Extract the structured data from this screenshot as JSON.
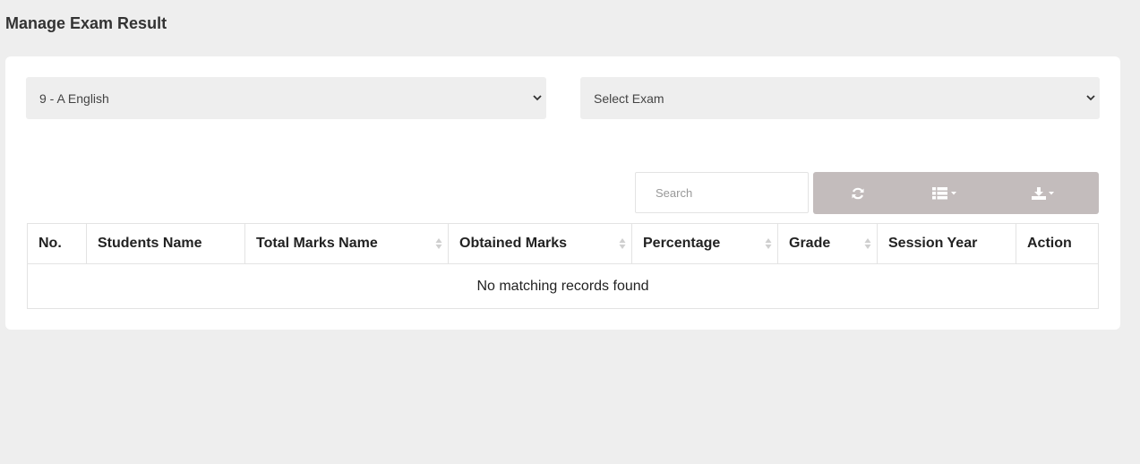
{
  "page": {
    "title": "Manage Exam Result"
  },
  "filters": {
    "class_subject": {
      "selected": "9 - A English"
    },
    "exam": {
      "selected": "Select Exam"
    }
  },
  "table_tools": {
    "search_placeholder": "Search",
    "icons": [
      "refresh-icon",
      "columns-icon",
      "export-icon"
    ],
    "toolbar_color": "#c3bcbc"
  },
  "table": {
    "columns": [
      {
        "label": "No.",
        "sortable": false
      },
      {
        "label": "Students Name",
        "sortable": false
      },
      {
        "label": "Total Marks Name",
        "sortable": true
      },
      {
        "label": "Obtained Marks",
        "sortable": true
      },
      {
        "label": "Percentage",
        "sortable": true
      },
      {
        "label": "Grade",
        "sortable": true
      },
      {
        "label": "Session Year",
        "sortable": false
      },
      {
        "label": "Action",
        "sortable": false
      }
    ],
    "empty_message": "No matching records found"
  }
}
